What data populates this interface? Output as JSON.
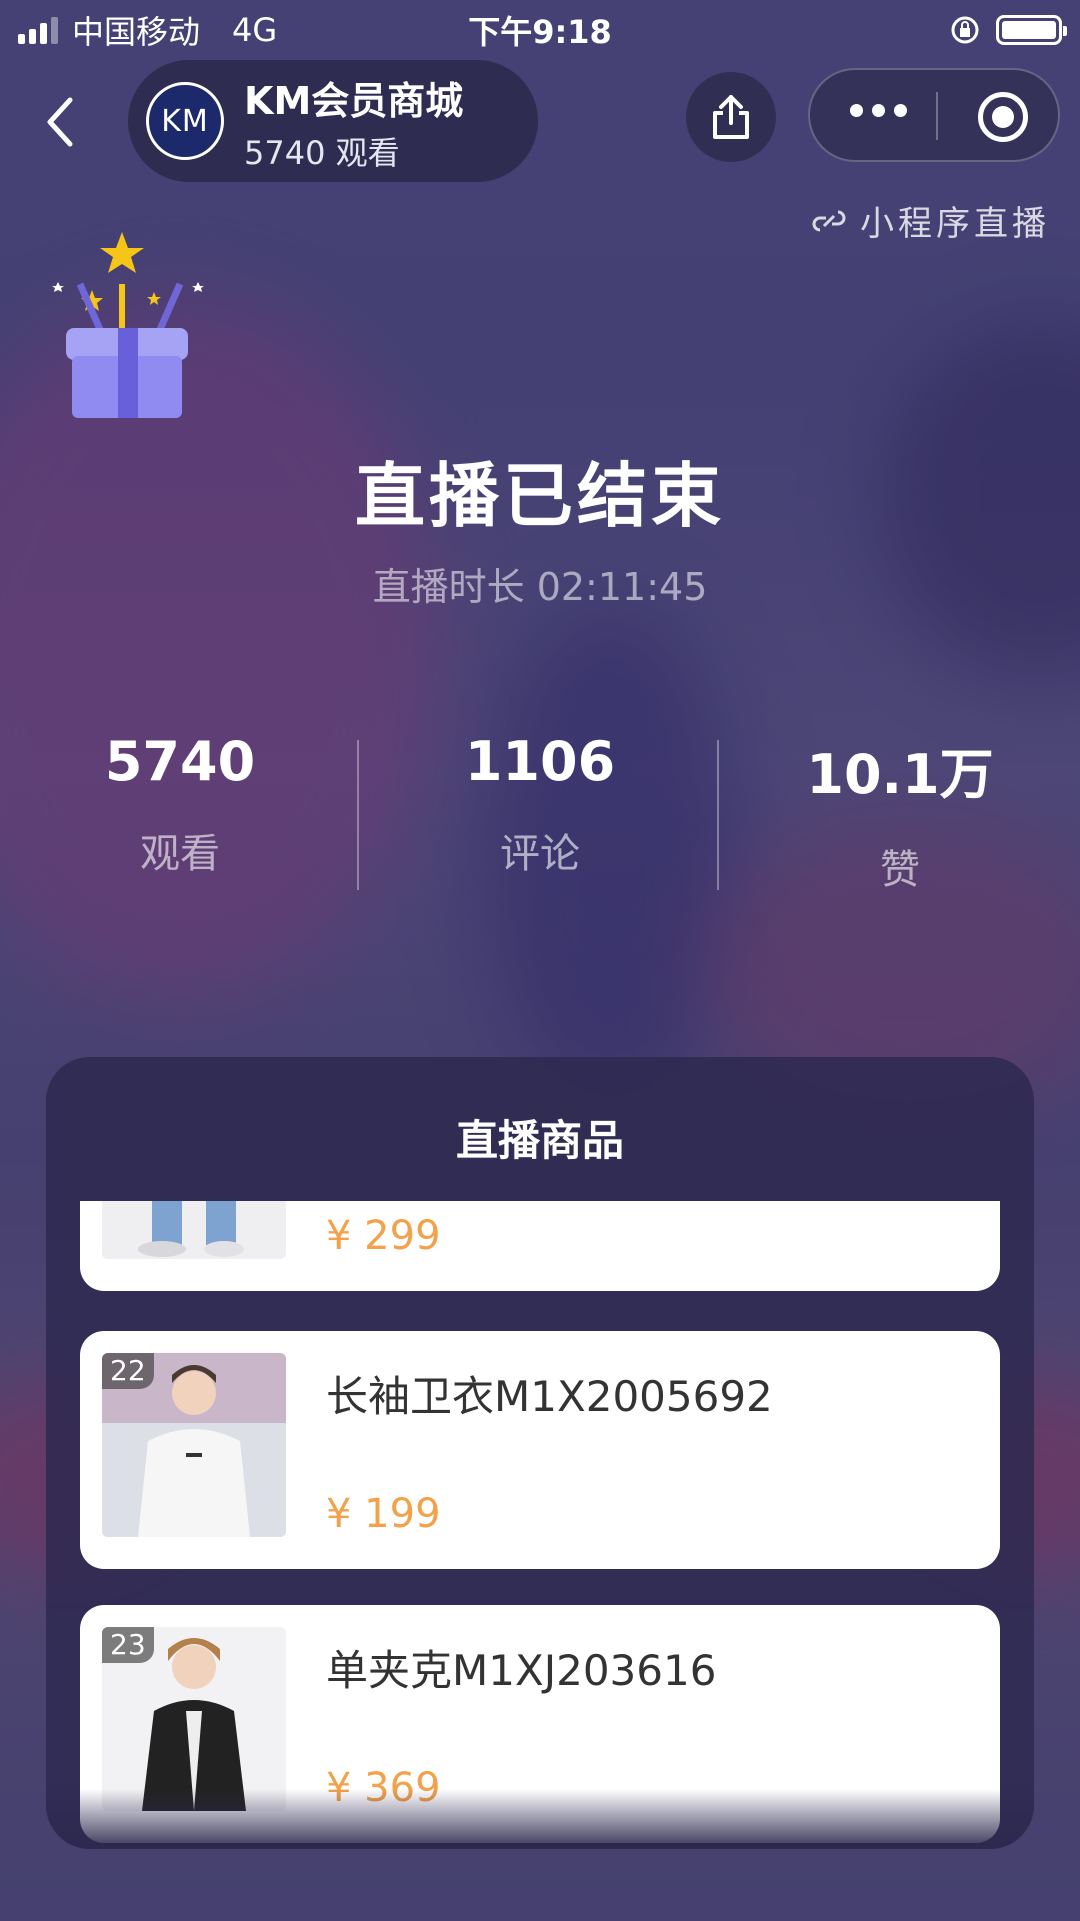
{
  "status_bar": {
    "carrier": "中国移动",
    "network": "4G",
    "time": "下午9:18"
  },
  "header": {
    "avatar_text": "KM",
    "room_title": "KM会员商城",
    "viewer_text": "5740 观看"
  },
  "mini_program_label": "小程序直播",
  "live_ended": {
    "title": "直播已结束",
    "duration": "直播时长 02:11:45"
  },
  "stats": [
    {
      "value": "5740",
      "label": "观看"
    },
    {
      "value": "1106",
      "label": "评论"
    },
    {
      "value": "10.1万",
      "label": "赞"
    }
  ],
  "products_panel": {
    "title": "直播商品",
    "items": [
      {
        "index": "",
        "name": "",
        "price": "¥ 299"
      },
      {
        "index": "22",
        "name": "长袖卫衣M1X2005692",
        "price": "¥ 199"
      },
      {
        "index": "23",
        "name": "单夹克M1XJ203616",
        "price": "¥ 369"
      }
    ]
  }
}
